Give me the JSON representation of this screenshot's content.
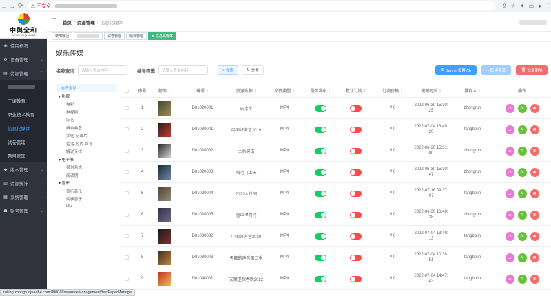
{
  "browser": {
    "insecure_label": "不安全"
  },
  "logo": {
    "name": "中舆全和",
    "sub": "ZHONG YU QUAN HE"
  },
  "sidebar": {
    "items": [
      {
        "label": "使用概况",
        "icon": "dashboard-icon",
        "chev": ""
      },
      {
        "label": "设备管理",
        "icon": "gear-icon",
        "chev": "⌄"
      },
      {
        "label": "资源管理",
        "icon": "document-icon",
        "chev": "⌄"
      },
      {
        "label": "",
        "sub": true
      },
      {
        "label": "三课教育",
        "sub": true
      },
      {
        "label": "职业技术教育",
        "sub": true
      },
      {
        "label": "信息化媒体",
        "sub": true,
        "active": true
      },
      {
        "label": "试卷管理",
        "sub": true
      },
      {
        "label": "题目管理",
        "sub": true
      },
      {
        "label": "版本管理",
        "icon": "version-icon",
        "chev": "⌄"
      },
      {
        "label": "资源统计",
        "icon": "chart-icon",
        "chev": "⌄"
      },
      {
        "label": "系统管理",
        "icon": "grid-icon",
        "chev": "⌄"
      },
      {
        "label": "账号管理",
        "icon": "user-icon",
        "chev": "⌄"
      }
    ]
  },
  "breadcrumb": {
    "home": "首页",
    "mid": "资源管理",
    "current": "信息化媒体"
  },
  "tags": {
    "t0": "使用概况",
    "t2": "试卷管理",
    "t3": "题目管理",
    "t4": "信息化媒体"
  },
  "page": {
    "title": "娱乐传媒"
  },
  "filters": {
    "name_label": "名称查询",
    "name_placeholder": "请输入查询内容",
    "code_label": "编号筛选",
    "code_placeholder": "请输入查询内容",
    "search": "搜索",
    "reset": "重置"
  },
  "actions": {
    "banner": "Banner设置 (0)",
    "add": "+ 新建资源",
    "delete": "批量删除"
  },
  "colors": {
    "accent": "#409eff",
    "switch_on": "#13ce66",
    "switch_off": "#ff4949",
    "sidebar_bg": "#30323c"
  },
  "tree": [
    {
      "label": "选择全部",
      "level": 1,
      "sel": true
    },
    {
      "label": "▾ 影视",
      "level": 1
    },
    {
      "label": "电影",
      "level": 2
    },
    {
      "label": "电视剧",
      "level": 2
    },
    {
      "label": "综艺",
      "level": 2
    },
    {
      "label": "舞台曲艺",
      "level": 2
    },
    {
      "label": "文化·纪录片",
      "level": 2
    },
    {
      "label": "生活·时尚·体育",
      "level": 2
    },
    {
      "label": "解说专栏",
      "level": 2
    },
    {
      "label": "▾ 电子书",
      "level": 1
    },
    {
      "label": "报刊杂志",
      "level": 2
    },
    {
      "label": "阅读馆",
      "level": 2
    },
    {
      "label": "▾ 音乐",
      "level": 1
    },
    {
      "label": "流行音乐",
      "level": 2
    },
    {
      "label": "民族音乐",
      "level": 2
    },
    {
      "label": "MV",
      "level": 2
    }
  ],
  "table": {
    "headers": [
      "序号",
      "封面",
      "编号",
      "资源名称",
      "文件类型",
      "是否发布",
      "默认订阅",
      "订阅价格",
      "更新时间",
      "操作人",
      "操作"
    ],
    "rows": [
      {
        "no": "1",
        "code": "D01020001",
        "name": "庆余年",
        "type": "MP4",
        "published": true,
        "default_sub": false,
        "price": "¥ 0",
        "time1": "2022-06-30 15:30:",
        "time2": "25",
        "op": "zhongrun",
        "c1": "#3b4a2e",
        "c2": "#a88a5a"
      },
      {
        "no": "2",
        "code": "D01030001",
        "name": "中国好声音2019",
        "type": "MP4",
        "published": true,
        "default_sub": false,
        "price": "¥ 0",
        "time1": "2022-07-04 13:49:",
        "time2": "20",
        "op": "tangbolin",
        "c1": "#2a1a1a",
        "c2": "#c04030"
      },
      {
        "no": "3",
        "code": "D01020002",
        "name": "士兵突击",
        "type": "MP4",
        "published": true,
        "default_sub": false,
        "price": "¥ 0",
        "time1": "2022-06-30 15:31:",
        "time2": "00",
        "op": "zhongrun",
        "c1": "#222",
        "c2": "#ddd"
      },
      {
        "no": "4",
        "code": "D01020003",
        "name": "鸡毛飞上天",
        "type": "MP4",
        "published": true,
        "default_sub": false,
        "price": "¥ 0",
        "time1": "2022-06-30 15:30:",
        "time2": "47",
        "op": "zhongrun",
        "c1": "#1a2a3a",
        "c2": "#6f8aa8"
      },
      {
        "no": "5",
        "code": "D01020004",
        "name": "2022人世间",
        "type": "MP4",
        "published": true,
        "default_sub": false,
        "price": "¥ 0",
        "time1": "2022-07-18 09:37:",
        "time2": "07",
        "op": "tangbolin",
        "c1": "#4a4035",
        "c2": "#9a8f7a"
      },
      {
        "no": "6",
        "code": "D01020005",
        "name": "雪中悍刀行",
        "type": "MP4",
        "published": true,
        "default_sub": false,
        "price": "¥ 0",
        "time1": "2022-06-30 16:48:",
        "time2": "38",
        "op": "zhongrun",
        "c1": "#2a3045",
        "c2": "#7a6a8a"
      },
      {
        "no": "7",
        "code": "D01030002",
        "name": "中国好声音2020",
        "type": "MP4",
        "published": true,
        "default_sub": false,
        "price": "¥ 0",
        "time1": "2022-07-04 13:49:",
        "time2": "13",
        "op": "tangbolin",
        "c1": "#1a1a1a",
        "c2": "#803030"
      },
      {
        "no": "8",
        "code": "D01030003",
        "name": "天籁的声音第二季",
        "type": "MP4",
        "published": true,
        "default_sub": false,
        "price": "¥ 0",
        "time1": "2022-07-04 10:38:",
        "time2": "51",
        "op": "tangbolin",
        "c1": "#3a2a20",
        "c2": "#c08a40"
      },
      {
        "no": "9",
        "code": "D01040001",
        "name": "安徽卫视春晚2022",
        "type": "MP4",
        "published": true,
        "default_sub": false,
        "price": "¥ 0",
        "time1": "2022-07-04 14:47:",
        "time2": "43",
        "op": "tangbolin",
        "c1": "#c03020",
        "c2": "#f0c060"
      }
    ]
  },
  "status_url": "ruijing.zhongrunjuanhe.com:8000/#/resourceManagement/testPaperManage"
}
